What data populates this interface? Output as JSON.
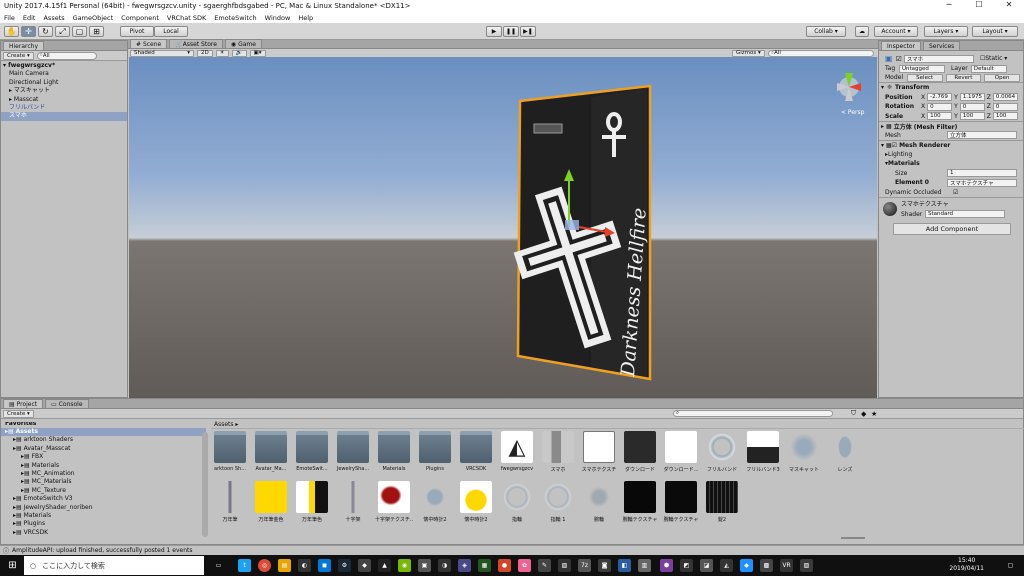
{
  "window": {
    "title": "Unity 2017.4.15f1 Personal (64bit) - fwegwrsgzcv.unity - sgaerghfbdsgabed - PC, Mac & Linux Standalone* <DX11>",
    "min": "─",
    "max": "☐",
    "close": "✕"
  },
  "menu": [
    "File",
    "Edit",
    "Assets",
    "GameObject",
    "Component",
    "VRChat SDK",
    "EmoteSwitch",
    "Window",
    "Help"
  ],
  "toolbar": {
    "pivot": "Pivot",
    "local": "Local",
    "play": "▶",
    "pause": "❚❚",
    "step": "▶❚",
    "collab": "Collab ▾",
    "cloud": "☁",
    "account": "Account ▾",
    "layers": "Layers ▾",
    "layout": "Layout ▾"
  },
  "hierarchy": {
    "tab": "Hierarchy",
    "create": "Create ▾",
    "search": "All",
    "scene": "fwegwrsgzcv*",
    "items": [
      {
        "label": "Main Camera",
        "indent": 1,
        "style": ""
      },
      {
        "label": "Directional Light",
        "indent": 1,
        "style": ""
      },
      {
        "label": "マスキャット",
        "indent": 1,
        "style": "arrow"
      },
      {
        "label": "Masscat",
        "indent": 1,
        "style": "arrow"
      },
      {
        "label": "フリルバンド",
        "indent": 1,
        "style": "blue"
      },
      {
        "label": "スマホ",
        "indent": 1,
        "style": "sel"
      }
    ]
  },
  "scene": {
    "tabs": [
      "Scene",
      "Asset Store",
      "Game"
    ],
    "shaded": "Shaded",
    "mode2d": "2D",
    "gizmos": "Gizmos ▾",
    "search": "All",
    "persp": "< Persp",
    "phone_text": "Darkness Hellfire"
  },
  "inspector": {
    "tabs": [
      "Inspector",
      "Services"
    ],
    "name": "スマホ",
    "static": "Static ▾",
    "tag_label": "Tag",
    "tag": "Untagged",
    "layer_label": "Layer",
    "layer": "Default",
    "model_label": "Model",
    "model_buttons": [
      "Select",
      "Revert",
      "Open"
    ],
    "transform": {
      "title": "Transform",
      "position": [
        "-2.769",
        "1.1975",
        "0.0064"
      ],
      "rotation": [
        "0",
        "0",
        "0"
      ],
      "scale": [
        "100",
        "100",
        "100"
      ],
      "labels": [
        "Position",
        "Rotation",
        "Scale"
      ],
      "axes": [
        "X",
        "Y",
        "Z"
      ]
    },
    "mesh_filter": {
      "title": "立方体 (Mesh Filter)",
      "mesh_label": "Mesh",
      "mesh": "立方体"
    },
    "mesh_renderer": {
      "title": "Mesh Renderer",
      "lighting": "Lighting",
      "materials": "Materials",
      "size_label": "Size",
      "size": "1",
      "element_label": "Element 0",
      "element": "スマホテクスチャ",
      "dyn_label": "Dynamic Occluded"
    },
    "material": {
      "name": "スマホテクスチャ",
      "shader_label": "Shader",
      "shader": "Standard"
    },
    "add_component": "Add Component"
  },
  "project": {
    "tabs": [
      "Project",
      "Console"
    ],
    "create": "Create ▾",
    "favorites": "Favorites",
    "tree": [
      {
        "label": "Assets",
        "indent": 0,
        "sel": true
      },
      {
        "label": "arktoon Shaders",
        "indent": 1
      },
      {
        "label": "Avatar_Masscat",
        "indent": 1
      },
      {
        "label": "FBX",
        "indent": 2
      },
      {
        "label": "Materials",
        "indent": 2
      },
      {
        "label": "MC_Animation",
        "indent": 2
      },
      {
        "label": "MC_Materials",
        "indent": 2
      },
      {
        "label": "MC_Texture",
        "indent": 2
      },
      {
        "label": "EmoteSwitch V3",
        "indent": 1
      },
      {
        "label": "JewelryShader_noriben",
        "indent": 1
      },
      {
        "label": "Materials",
        "indent": 1
      },
      {
        "label": "Plugins",
        "indent": 1
      },
      {
        "label": "VRCSDK",
        "indent": 1
      }
    ],
    "breadcrumb": "Assets ▸"
  },
  "assets": [
    {
      "label": "arktoon Sh...",
      "kind": "folder"
    },
    {
      "label": "Avatar_Ma...",
      "kind": "folder"
    },
    {
      "label": "EmoteSwit...",
      "kind": "folder"
    },
    {
      "label": "JewelrySha...",
      "kind": "folder"
    },
    {
      "label": "Materials",
      "kind": "folder"
    },
    {
      "label": "Plugins",
      "kind": "folder"
    },
    {
      "label": "VRCSDK",
      "kind": "folder"
    },
    {
      "label": "fwegwrsgzcv",
      "kind": "unity"
    },
    {
      "label": "スマホ",
      "kind": "phone"
    },
    {
      "label": "スマホテクスチ",
      "kind": "tex"
    },
    {
      "label": "ダウンロード",
      "kind": "dark"
    },
    {
      "label": "ダウンロード...",
      "kind": "white"
    },
    {
      "label": "フリルバンド",
      "kind": "ring"
    },
    {
      "label": "フリルバンド3",
      "kind": "bw"
    },
    {
      "label": "マスキャット",
      "kind": "mesh"
    },
    {
      "label": "レンズ",
      "kind": "lens"
    },
    {
      "label": "万年筆",
      "kind": "pen"
    },
    {
      "label": "万年筆金色",
      "kind": "yellow"
    },
    {
      "label": "万年筆色",
      "kind": "ybw"
    },
    {
      "label": "十字架",
      "kind": "cross"
    },
    {
      "label": "十字架テクスチ...",
      "kind": "red"
    },
    {
      "label": "懐中時計2",
      "kind": "watch"
    },
    {
      "label": "懐中時計2",
      "kind": "ywatch"
    },
    {
      "label": "指輪",
      "kind": "ring2"
    },
    {
      "label": "指輪 1",
      "kind": "ring2"
    },
    {
      "label": "腕輪",
      "kind": "mesh2"
    },
    {
      "label": "腕輪テクスチャ",
      "kind": "black"
    },
    {
      "label": "腕輪テクスチャ",
      "kind": "black2"
    },
    {
      "label": "錠2",
      "kind": "stripes"
    }
  ],
  "status": "AmplitudeAPI: upload finished, successfully posted 1 events",
  "taskbar": {
    "search": "ここに入力して検索",
    "time": "15:40",
    "date": "2019/04/11"
  }
}
